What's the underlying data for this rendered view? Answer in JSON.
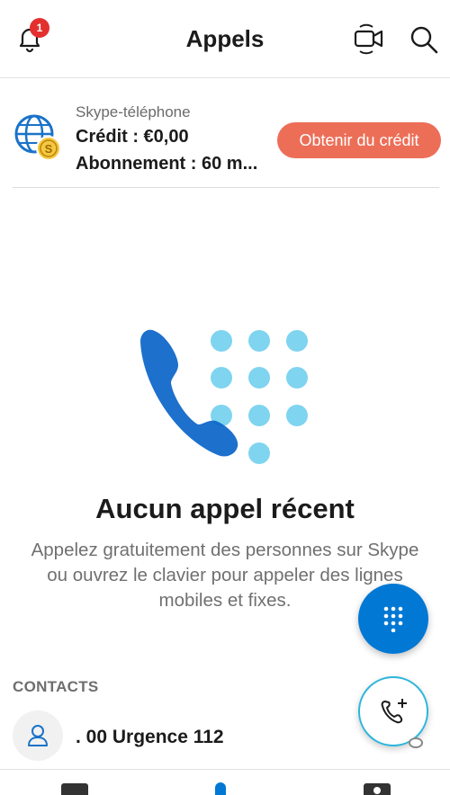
{
  "header": {
    "title": "Appels",
    "notification_count": "1",
    "icons": [
      "bell-icon",
      "video-call-icon",
      "search-icon"
    ]
  },
  "credit": {
    "service": "Skype-téléphone",
    "balance": "Crédit : €0,00",
    "subscription": "Abonnement : 60 m...",
    "button_label": "Obtenir du crédit",
    "button_color": "#ec6e57"
  },
  "empty_state": {
    "title": "Aucun appel récent",
    "body": "Appelez gratuitement des personnes sur Skype ou ouvrez le clavier pour appeler des lignes mobiles et fixes."
  },
  "contacts": {
    "header": "CONTACTS",
    "items": [
      {
        "name": ". 00 Urgence 112"
      }
    ]
  },
  "colors": {
    "accent": "#0078d4",
    "illustration_dots": "#7fd4ef",
    "new_call_ring": "#2db6dc",
    "badge": "#e3302f"
  },
  "bottom_nav": [
    "chat-icon",
    "calls-icon",
    "contacts-icon"
  ]
}
